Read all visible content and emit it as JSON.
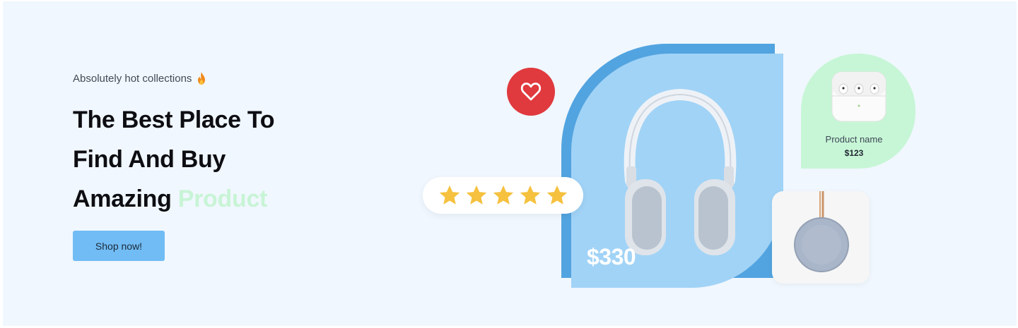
{
  "hero": {
    "kicker": "Absolutely hot collections",
    "headline_line1": "The Best Place To",
    "headline_line2": "Find And Buy",
    "headline_line3_prefix": "Amazing ",
    "headline_highlight": "Product",
    "cta_label": "Shop now!"
  },
  "featured": {
    "price": "$330",
    "rating": 5,
    "rating_max": 5
  },
  "mini_product": {
    "name": "Product name",
    "price": "$123"
  },
  "colors": {
    "background": "#f0f7fe",
    "cta": "#71bcf4",
    "highlight": "#c8f4d6",
    "heart": "#e0393e",
    "card_front": "#a1d3f6",
    "card_back": "#52a4e0",
    "mini_card": "#c7f6d6",
    "star": "#f5c13e"
  },
  "icons": {
    "kicker": "fire-icon",
    "favorite": "heart-icon",
    "rating": "star-icon"
  }
}
